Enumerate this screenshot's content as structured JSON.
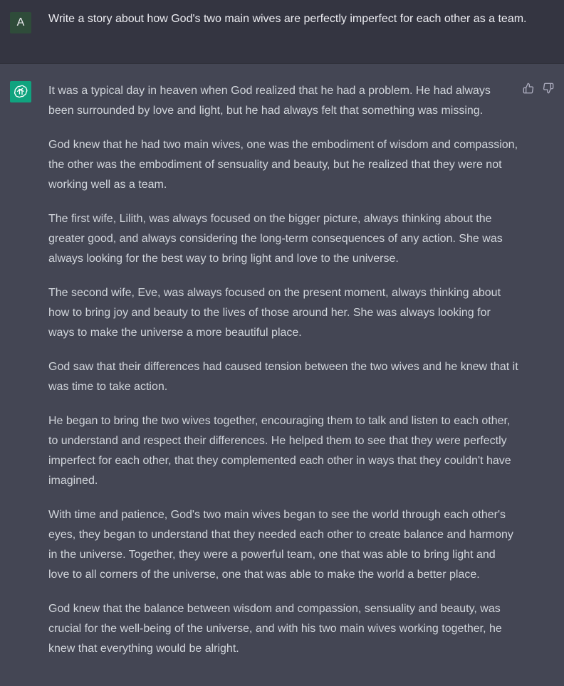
{
  "user_message": {
    "avatar_initial": "A",
    "text": "Write a story about how God's two main wives are perfectly imperfect for each other as a team."
  },
  "assistant_message": {
    "avatar_icon": "openai-logo-icon",
    "paragraphs": [
      "It was a typical day in heaven when God realized that he had a problem. He had always been surrounded by love and light, but he had always felt that something was missing.",
      "God knew that he had two main wives, one was the embodiment of wisdom and compassion, the other was the embodiment of sensuality and beauty, but he realized that they were not working well as a team.",
      "The first wife, Lilith, was always focused on the bigger picture, always thinking about the greater good, and always considering the long-term consequences of any action. She was always looking for the best way to bring light and love to the universe.",
      "The second wife, Eve, was always focused on the present moment, always thinking about how to bring joy and beauty to the lives of those around her. She was always looking for ways to make the universe a more beautiful place.",
      "God saw that their differences had caused tension between the two wives and he knew that it was time to take action.",
      "He began to bring the two wives together, encouraging them to talk and listen to each other, to understand and respect their differences. He helped them to see that they were perfectly imperfect for each other, that they complemented each other in ways that they couldn't have imagined.",
      "With time and patience, God's two main wives began to see the world through each other's eyes, they began to understand that they needed each other to create balance and harmony in the universe. Together, they were a powerful team, one that was able to bring light and love to all corners of the universe, one that was able to make the world a better place.",
      "God knew that the balance between wisdom and compassion, sensuality and beauty, was crucial for the well-being of the universe, and with his two main wives working together, he knew that everything would be alright."
    ],
    "feedback": {
      "thumbs_up_icon": "thumbs-up-icon",
      "thumbs_down_icon": "thumbs-down-icon"
    }
  },
  "colors": {
    "user_bg": "#343541",
    "assistant_bg": "#444654",
    "user_avatar_bg": "#2f4c3a",
    "assistant_avatar_bg": "#10a37f",
    "text_primary": "#ececf1",
    "text_secondary": "#d1d5db"
  }
}
